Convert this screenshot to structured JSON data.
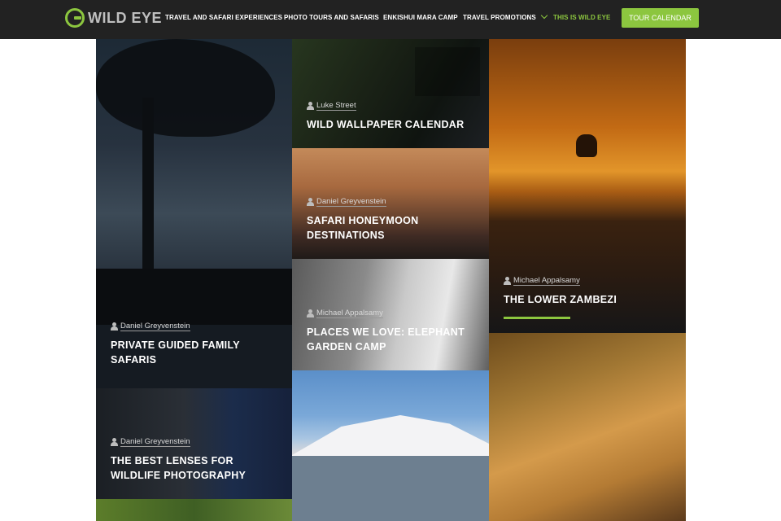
{
  "brand": {
    "name": "WILD EYE"
  },
  "nav": {
    "items": [
      {
        "label": "TRAVEL AND SAFARI EXPERIENCES",
        "active": false
      },
      {
        "label": "PHOTO TOURS AND SAFARIS",
        "active": false
      },
      {
        "label": "ENKISHUI MARA CAMP",
        "active": false
      },
      {
        "label": "TRAVEL PROMOTIONS",
        "active": false
      },
      {
        "label": "THIS IS WILD EYE",
        "active": true
      }
    ],
    "cta_label": "TOUR CALENDAR"
  },
  "colors": {
    "accent": "#8cc63f",
    "header_bg": "#222222"
  },
  "cards": [
    {
      "author": "Daniel Greyvenstein",
      "title": "PRIVATE GUIDED FAMILY SAFARIS"
    },
    {
      "author": "Luke Street",
      "title": "WILD WALLPAPER CALENDAR"
    },
    {
      "author": "Daniel Greyvenstein",
      "title": "SAFARI HONEYMOON DESTINATIONS"
    },
    {
      "author": "Michael Appalsamy",
      "title": "PLACES WE LOVE: ELEPHANT GARDEN CAMP"
    },
    {
      "author": "Michael Appalsamy",
      "title": "THE LOWER ZAMBEZI"
    },
    {
      "author": "Daniel Greyvenstein",
      "title": "THE BEST LENSES FOR WILDLIFE PHOTOGRAPHY"
    }
  ]
}
